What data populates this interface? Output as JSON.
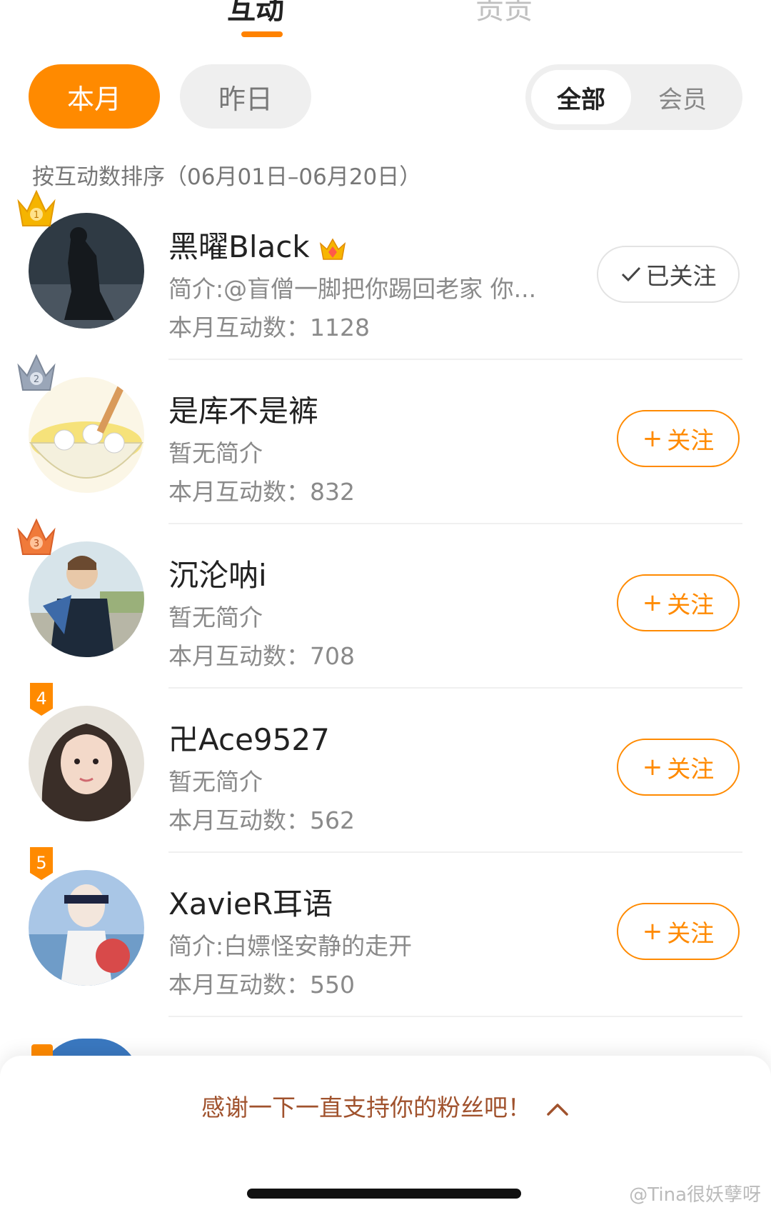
{
  "top_tabs": [
    {
      "label": "互动",
      "active": true
    },
    {
      "label": "贡贡",
      "active": false
    }
  ],
  "period": {
    "active_label": "本月",
    "inactive_label": "昨日"
  },
  "filter": {
    "selected_label": "全部",
    "other_label": "会员"
  },
  "sort_label": "按互动数排序（06月01日–06月20日）",
  "fans": [
    {
      "rank": "1",
      "name": "黑曜Black",
      "has_crown_icon": true,
      "bio": "简介:@盲僧一脚把你踢回老家 你...",
      "count": "本月互动数：1128",
      "follow_label": "已关注",
      "followed": true
    },
    {
      "rank": "2",
      "name": "是库不是裤",
      "has_crown_icon": false,
      "bio": "暂无简介",
      "count": "本月互动数：832",
      "follow_label": "关注",
      "followed": false
    },
    {
      "rank": "3",
      "name": "沉沦呐i",
      "has_crown_icon": false,
      "bio": "暂无简介",
      "count": "本月互动数：708",
      "follow_label": "关注",
      "followed": false
    },
    {
      "rank": "4",
      "name": "卍Ace9527",
      "has_crown_icon": false,
      "bio": "暂无简介",
      "count": "本月互动数：562",
      "follow_label": "关注",
      "followed": false
    },
    {
      "rank": "5",
      "name": "XavieR耳语",
      "has_crown_icon": false,
      "bio": "简介:白嫖怪安静的走开",
      "count": "本月互动数：550",
      "follow_label": "关注",
      "followed": false
    }
  ],
  "bottom_sheet": {
    "text": "感谢一下一直支持你的粉丝吧！"
  },
  "watermark": "@Tina很妖孽呀",
  "colors": {
    "accent": "#ff8a00",
    "gold": "#f5b400",
    "silver": "#9aa6b8",
    "bronze": "#f07a3a",
    "thanks_text": "#a0522d"
  }
}
